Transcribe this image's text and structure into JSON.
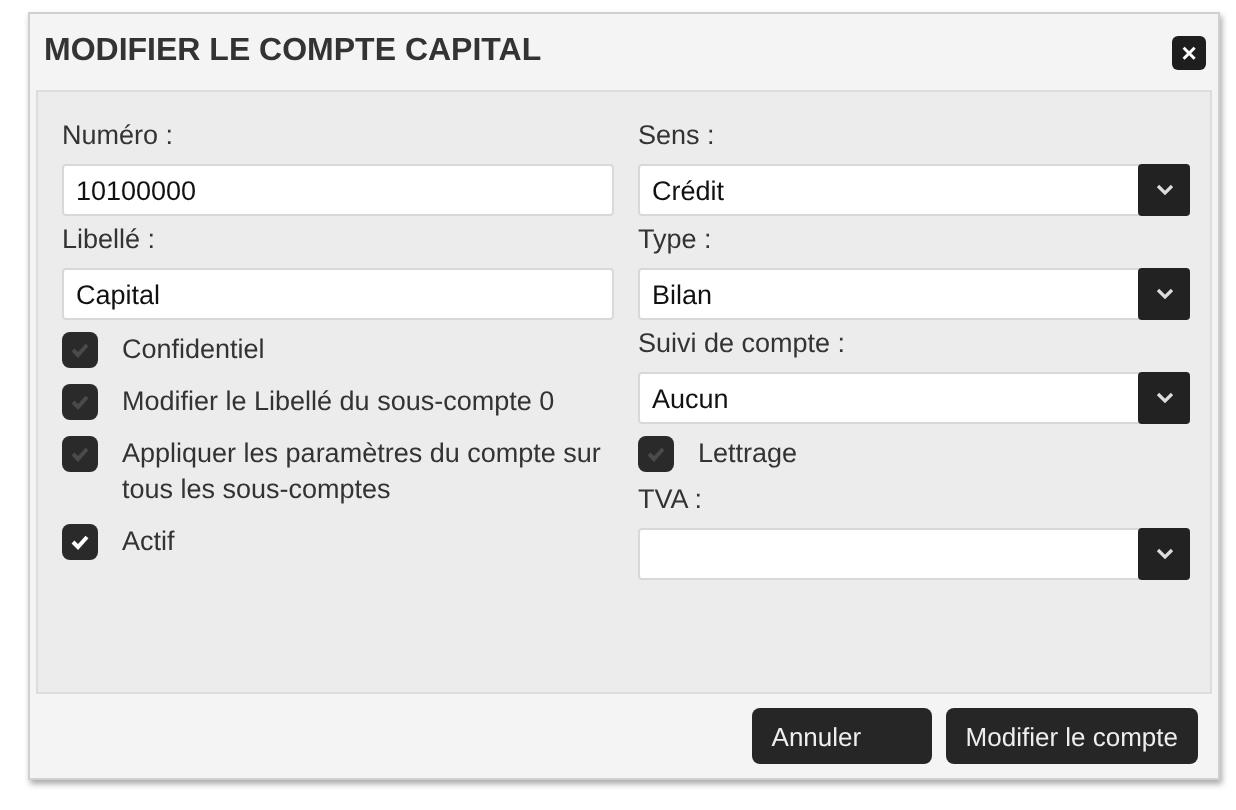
{
  "window": {
    "title": "MODIFIER LE COMPTE CAPITAL",
    "close": "×"
  },
  "left": [
    {
      "kind": "field",
      "label": "Numéro :",
      "value": "10100000"
    },
    {
      "kind": "field",
      "label": "Libellé :",
      "value": "Capital"
    },
    {
      "kind": "checkbox",
      "label": "Confidentiel",
      "checked": false
    },
    {
      "kind": "checkbox",
      "label": "Modifier le Libellé du sous-compte 0",
      "checked": false
    },
    {
      "kind": "checkbox",
      "label": "Appliquer les paramètres du compte sur tous les sous-comptes",
      "checked": false
    },
    {
      "kind": "checkbox",
      "label": "Actif",
      "checked": true
    }
  ],
  "right": [
    {
      "kind": "select",
      "label": "Sens :",
      "value": "Crédit"
    },
    {
      "kind": "select",
      "label": "Type :",
      "value": "Bilan"
    },
    {
      "kind": "select",
      "label": "Suivi de compte :",
      "value": "Aucun"
    },
    {
      "kind": "checkbox",
      "label": "Lettrage",
      "checked": false
    },
    {
      "kind": "select",
      "label": "TVA :"
    }
  ],
  "buttons": [
    "Annuler",
    "Modifier le compte"
  ]
}
